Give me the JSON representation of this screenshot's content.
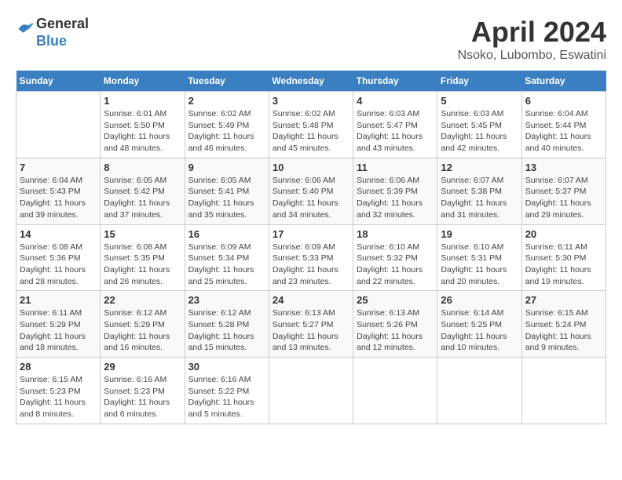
{
  "header": {
    "logo_line1": "General",
    "logo_line2": "Blue",
    "month_title": "April 2024",
    "location": "Nsoko, Lubombo, Eswatini"
  },
  "weekdays": [
    "Sunday",
    "Monday",
    "Tuesday",
    "Wednesday",
    "Thursday",
    "Friday",
    "Saturday"
  ],
  "weeks": [
    [
      {
        "day": "",
        "info": ""
      },
      {
        "day": "1",
        "info": "Sunrise: 6:01 AM\nSunset: 5:50 PM\nDaylight: 11 hours\nand 48 minutes."
      },
      {
        "day": "2",
        "info": "Sunrise: 6:02 AM\nSunset: 5:49 PM\nDaylight: 11 hours\nand 46 minutes."
      },
      {
        "day": "3",
        "info": "Sunrise: 6:02 AM\nSunset: 5:48 PM\nDaylight: 11 hours\nand 45 minutes."
      },
      {
        "day": "4",
        "info": "Sunrise: 6:03 AM\nSunset: 5:47 PM\nDaylight: 11 hours\nand 43 minutes."
      },
      {
        "day": "5",
        "info": "Sunrise: 6:03 AM\nSunset: 5:45 PM\nDaylight: 11 hours\nand 42 minutes."
      },
      {
        "day": "6",
        "info": "Sunrise: 6:04 AM\nSunset: 5:44 PM\nDaylight: 11 hours\nand 40 minutes."
      }
    ],
    [
      {
        "day": "7",
        "info": "Sunrise: 6:04 AM\nSunset: 5:43 PM\nDaylight: 11 hours\nand 39 minutes."
      },
      {
        "day": "8",
        "info": "Sunrise: 6:05 AM\nSunset: 5:42 PM\nDaylight: 11 hours\nand 37 minutes."
      },
      {
        "day": "9",
        "info": "Sunrise: 6:05 AM\nSunset: 5:41 PM\nDaylight: 11 hours\nand 35 minutes."
      },
      {
        "day": "10",
        "info": "Sunrise: 6:06 AM\nSunset: 5:40 PM\nDaylight: 11 hours\nand 34 minutes."
      },
      {
        "day": "11",
        "info": "Sunrise: 6:06 AM\nSunset: 5:39 PM\nDaylight: 11 hours\nand 32 minutes."
      },
      {
        "day": "12",
        "info": "Sunrise: 6:07 AM\nSunset: 5:38 PM\nDaylight: 11 hours\nand 31 minutes."
      },
      {
        "day": "13",
        "info": "Sunrise: 6:07 AM\nSunset: 5:37 PM\nDaylight: 11 hours\nand 29 minutes."
      }
    ],
    [
      {
        "day": "14",
        "info": "Sunrise: 6:08 AM\nSunset: 5:36 PM\nDaylight: 11 hours\nand 28 minutes."
      },
      {
        "day": "15",
        "info": "Sunrise: 6:08 AM\nSunset: 5:35 PM\nDaylight: 11 hours\nand 26 minutes."
      },
      {
        "day": "16",
        "info": "Sunrise: 6:09 AM\nSunset: 5:34 PM\nDaylight: 11 hours\nand 25 minutes."
      },
      {
        "day": "17",
        "info": "Sunrise: 6:09 AM\nSunset: 5:33 PM\nDaylight: 11 hours\nand 23 minutes."
      },
      {
        "day": "18",
        "info": "Sunrise: 6:10 AM\nSunset: 5:32 PM\nDaylight: 11 hours\nand 22 minutes."
      },
      {
        "day": "19",
        "info": "Sunrise: 6:10 AM\nSunset: 5:31 PM\nDaylight: 11 hours\nand 20 minutes."
      },
      {
        "day": "20",
        "info": "Sunrise: 6:11 AM\nSunset: 5:30 PM\nDaylight: 11 hours\nand 19 minutes."
      }
    ],
    [
      {
        "day": "21",
        "info": "Sunrise: 6:11 AM\nSunset: 5:29 PM\nDaylight: 11 hours\nand 18 minutes."
      },
      {
        "day": "22",
        "info": "Sunrise: 6:12 AM\nSunset: 5:29 PM\nDaylight: 11 hours\nand 16 minutes."
      },
      {
        "day": "23",
        "info": "Sunrise: 6:12 AM\nSunset: 5:28 PM\nDaylight: 11 hours\nand 15 minutes."
      },
      {
        "day": "24",
        "info": "Sunrise: 6:13 AM\nSunset: 5:27 PM\nDaylight: 11 hours\nand 13 minutes."
      },
      {
        "day": "25",
        "info": "Sunrise: 6:13 AM\nSunset: 5:26 PM\nDaylight: 11 hours\nand 12 minutes."
      },
      {
        "day": "26",
        "info": "Sunrise: 6:14 AM\nSunset: 5:25 PM\nDaylight: 11 hours\nand 10 minutes."
      },
      {
        "day": "27",
        "info": "Sunrise: 6:15 AM\nSunset: 5:24 PM\nDaylight: 11 hours\nand 9 minutes."
      }
    ],
    [
      {
        "day": "28",
        "info": "Sunrise: 6:15 AM\nSunset: 5:23 PM\nDaylight: 11 hours\nand 8 minutes."
      },
      {
        "day": "29",
        "info": "Sunrise: 6:16 AM\nSunset: 5:23 PM\nDaylight: 11 hours\nand 6 minutes."
      },
      {
        "day": "30",
        "info": "Sunrise: 6:16 AM\nSunset: 5:22 PM\nDaylight: 11 hours\nand 5 minutes."
      },
      {
        "day": "",
        "info": ""
      },
      {
        "day": "",
        "info": ""
      },
      {
        "day": "",
        "info": ""
      },
      {
        "day": "",
        "info": ""
      }
    ]
  ]
}
